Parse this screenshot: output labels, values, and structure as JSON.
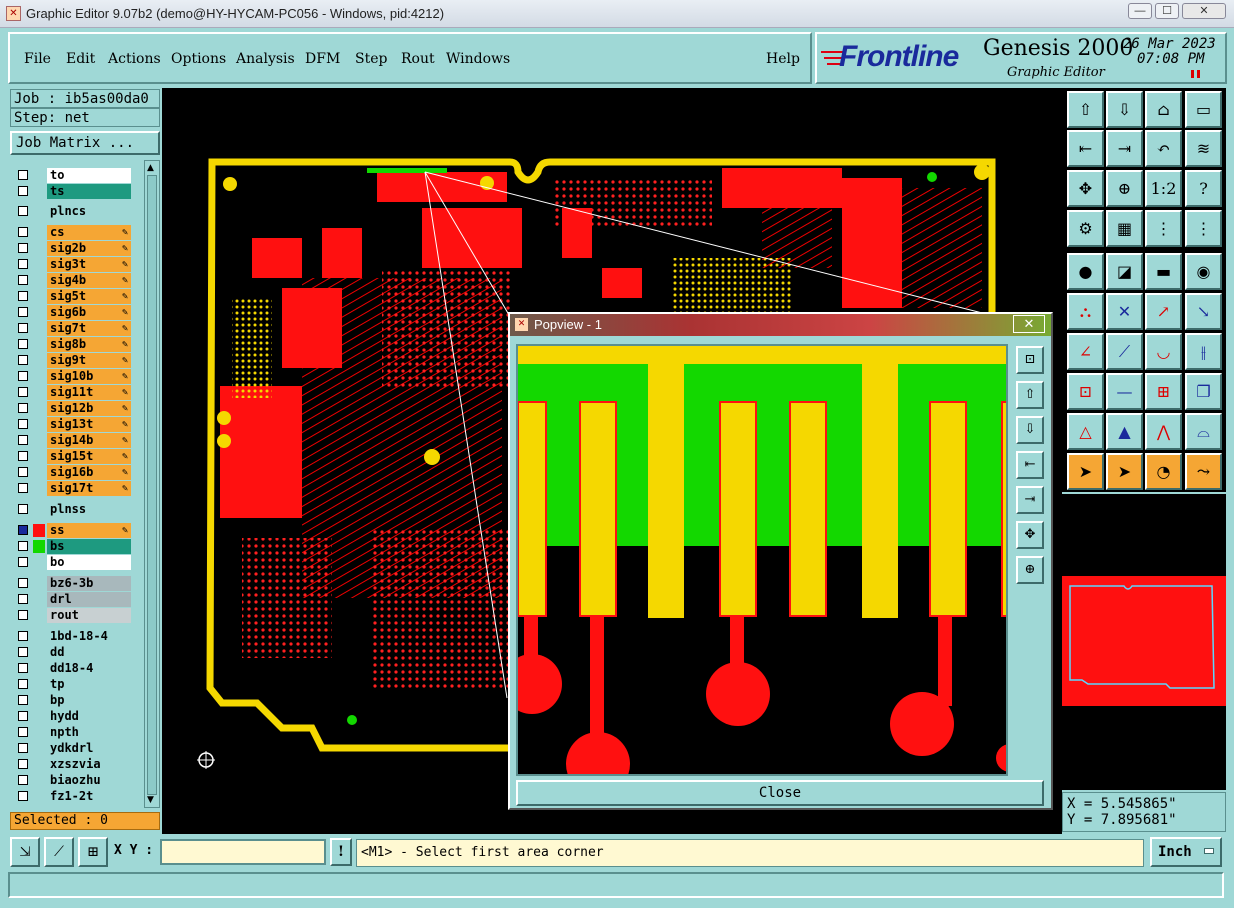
{
  "window": {
    "title": "Graphic Editor 9.07b2 (demo@HY-HYCAM-PC056 - Windows, pid:4212)",
    "min": "—",
    "max": "☐",
    "close": "✕"
  },
  "menu": {
    "items": [
      "File",
      "Edit",
      "Actions",
      "Options",
      "Analysis",
      "DFM",
      "Step",
      "Rout",
      "Windows"
    ],
    "help": "Help"
  },
  "logo": {
    "brand": "Frontline",
    "product": "Genesis 2000",
    "subtitle": "Graphic Editor",
    "date": "26 Mar 2023",
    "time": "07:08 PM"
  },
  "job": {
    "job_label": "Job : ib5as00da0",
    "step_label": "Step: net",
    "matrix_button": "Job Matrix ..."
  },
  "layers": [
    {
      "name": "to",
      "color": "#ffffff"
    },
    {
      "name": "ts",
      "color": "#1e9a80"
    },
    {
      "name": "plncs",
      "color": "#9fd8d6"
    },
    {
      "name": "cs",
      "color": "#f5a634"
    },
    {
      "name": "sig2b",
      "color": "#f5a634"
    },
    {
      "name": "sig3t",
      "color": "#f5a634"
    },
    {
      "name": "sig4b",
      "color": "#f5a634"
    },
    {
      "name": "sig5t",
      "color": "#f5a634"
    },
    {
      "name": "sig6b",
      "color": "#f5a634"
    },
    {
      "name": "sig7t",
      "color": "#f5a634"
    },
    {
      "name": "sig8b",
      "color": "#f5a634"
    },
    {
      "name": "sig9t",
      "color": "#f5a634"
    },
    {
      "name": "sig10b",
      "color": "#f5a634"
    },
    {
      "name": "sig11t",
      "color": "#f5a634"
    },
    {
      "name": "sig12b",
      "color": "#f5a634"
    },
    {
      "name": "sig13t",
      "color": "#f5a634"
    },
    {
      "name": "sig14b",
      "color": "#f5a634"
    },
    {
      "name": "sig15t",
      "color": "#f5a634"
    },
    {
      "name": "sig16b",
      "color": "#f5a634"
    },
    {
      "name": "sig17t",
      "color": "#f5a634"
    },
    {
      "name": "plnss",
      "color": "#9fd8d6"
    },
    {
      "name": "ss",
      "color": "#f5a634"
    },
    {
      "name": "bs",
      "color": "#1e9a80"
    },
    {
      "name": "bo",
      "color": "#ffffff"
    },
    {
      "name": "bz6-3b",
      "color": "#a8b8bc"
    },
    {
      "name": "drl",
      "color": "#a8b8bc"
    },
    {
      "name": "rout",
      "color": "#c8d0d2"
    },
    {
      "name": "1bd-18-4",
      "color": "#9fd8d6"
    },
    {
      "name": "dd",
      "color": "#9fd8d6"
    },
    {
      "name": "dd18-4",
      "color": "#9fd8d6"
    },
    {
      "name": "tp",
      "color": "#9fd8d6"
    },
    {
      "name": "bp",
      "color": "#9fd8d6"
    },
    {
      "name": "hydd",
      "color": "#9fd8d6"
    },
    {
      "name": "npth",
      "color": "#9fd8d6"
    },
    {
      "name": "ydkdrl",
      "color": "#9fd8d6"
    },
    {
      "name": "xzszvia",
      "color": "#9fd8d6"
    },
    {
      "name": "biaozhu",
      "color": "#9fd8d6"
    },
    {
      "name": "fz1-2t",
      "color": "#9fd8d6"
    }
  ],
  "selected": "Selected : 0",
  "popview": {
    "title": "Popview - 1",
    "close_label": "Close"
  },
  "coords": {
    "x": "X = 5.545865\"",
    "y": "Y = 7.895681\""
  },
  "cmd": {
    "xy_label": "X Y :",
    "xy_value": "",
    "message": "<M1> - Select first area corner",
    "units": "Inch"
  },
  "colors": {
    "panel": "#9fd8d6",
    "orange": "#f5a634",
    "red": "#ff0000",
    "yellow": "#f5d800",
    "green": "#13d800"
  }
}
